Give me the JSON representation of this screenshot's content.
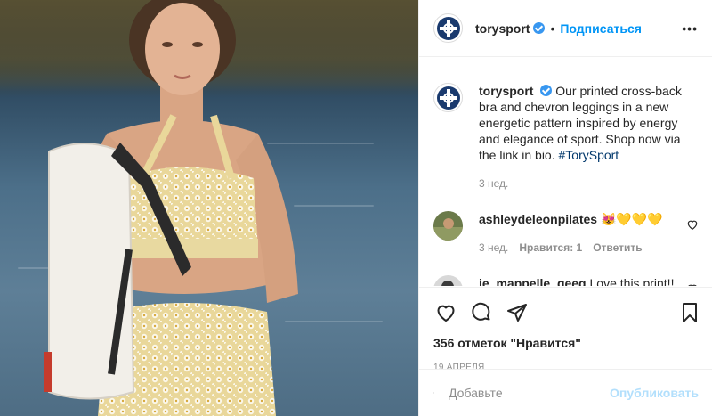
{
  "post": {
    "image_alt": "Model in printed sports bra and leggings with backpack by the water"
  },
  "header": {
    "username": "torysport",
    "separator": "•",
    "follow_label": "Подписаться",
    "more_label": "•••"
  },
  "caption": {
    "username": "torysport",
    "text": "Our printed cross-back bra and chevron leggings in a new energetic pattern inspired by energy and elegance of sport. Shop now via the link in bio.",
    "hashtag": "#TorySport",
    "time": "3 нед."
  },
  "comments": [
    {
      "username": "ashleydeleonpilates",
      "text": "😻💛💛💛",
      "time": "3 нед.",
      "likes_label": "Нравится: 1",
      "reply_label": "Ответить"
    },
    {
      "username": "je_mappelle_geeg",
      "text": "Love this print!!",
      "time": "",
      "likes_label": "",
      "reply_label": ""
    }
  ],
  "actions": {
    "likes_text": "356 отметок \"Нравится\"",
    "date": "19 АПРЕЛЯ"
  },
  "add_comment": {
    "placeholder": "Добавьте",
    "publish_label": "Опубликовать"
  },
  "colors": {
    "brand_navy": "#1a3a6e",
    "verified_blue": "#3897f0",
    "follow_blue": "#0095f6",
    "publish_disabled": "#b2dffc"
  },
  "icons": [
    "tory-logo-icon",
    "verified-icon",
    "more-icon",
    "heart-icon",
    "comment-icon",
    "share-icon",
    "bookmark-icon",
    "emoji-icon"
  ]
}
